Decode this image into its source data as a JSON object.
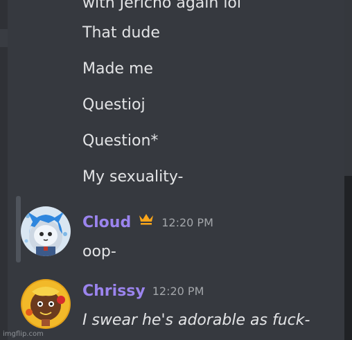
{
  "messages_top": [
    "with Jericho again lol",
    "That dude",
    "Made me",
    "Questioj",
    "Question*",
    "My sexuality-"
  ],
  "cloud": {
    "username": "Cloud",
    "timestamp": "12:20 PM",
    "text": "oop-"
  },
  "chrissy": {
    "username": "Chrissy",
    "timestamp": "12:20 PM",
    "text": "I swear he's adorable as fuck-"
  },
  "watermark": "imgflip.com",
  "colors": {
    "background": "#36393f",
    "username": "#9b84ee",
    "crown": "#faa61a",
    "timestamp": "#a3a6aa"
  },
  "icons": {
    "owner_badge": "crown-icon"
  }
}
